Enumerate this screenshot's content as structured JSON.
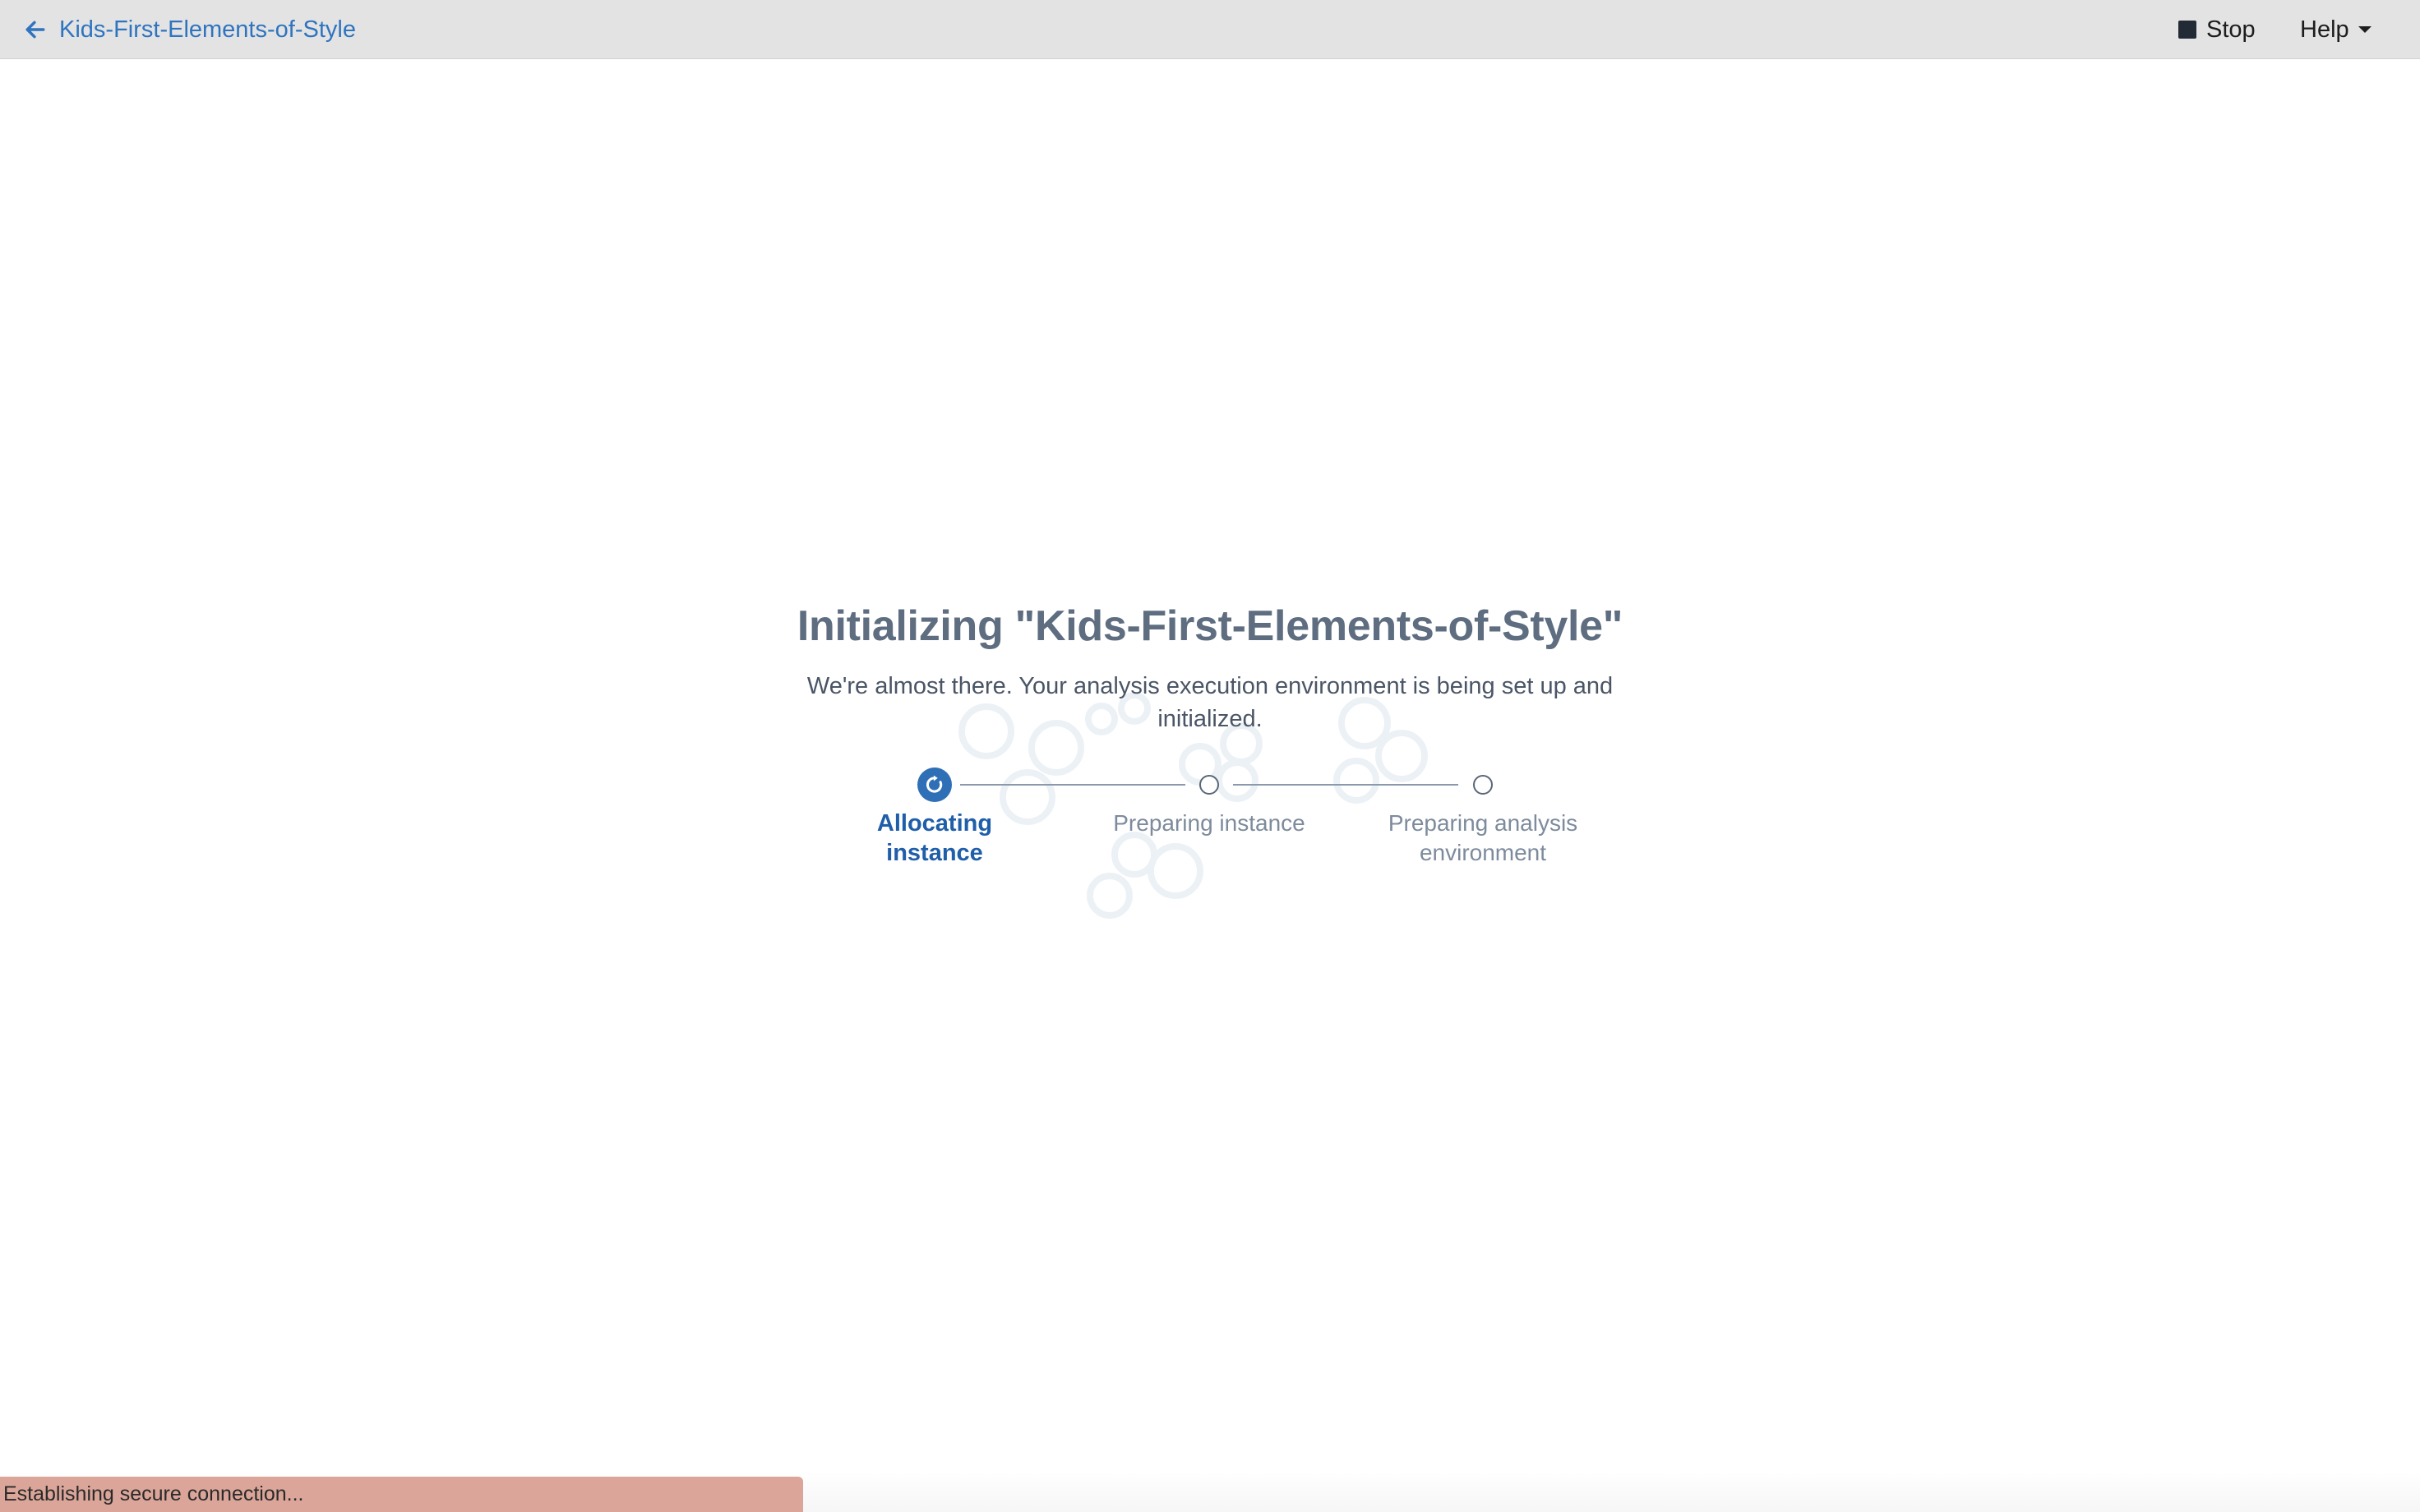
{
  "topbar": {
    "back_label": "Kids-First-Elements-of-Style",
    "stop_label": "Stop",
    "help_label": "Help"
  },
  "main": {
    "title": "Initializing \"Kids-First-Elements-of-Style\"",
    "subtitle": "We're almost there. Your analysis execution environment is being set up and initialized.",
    "steps": [
      {
        "label": "Allocating instance",
        "state": "active"
      },
      {
        "label": "Preparing instance",
        "state": "pending"
      },
      {
        "label": "Preparing analysis environment",
        "state": "pending"
      }
    ]
  },
  "status": {
    "text": "Establishing secure connection..."
  },
  "colors": {
    "accent": "#2f74c0",
    "active_step": "#2f6fb6",
    "topbar_bg": "#e3e3e3",
    "status_bg": "#dba699"
  },
  "icons": {
    "back": "arrow-left-icon",
    "stop": "stop-square-icon",
    "help": "caret-down-icon",
    "active_step": "refresh-icon"
  }
}
